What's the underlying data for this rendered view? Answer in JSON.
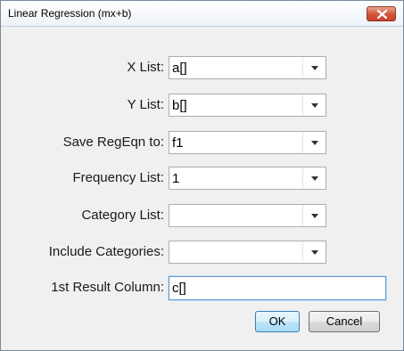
{
  "dialog": {
    "title": "Linear Regression (mx+b)"
  },
  "fields": [
    {
      "label": "X List:",
      "value": "a[]"
    },
    {
      "label": "Y List:",
      "value": "b[]"
    },
    {
      "label": "Save RegEqn to:",
      "value": "f1"
    },
    {
      "label": "Frequency List:",
      "value": "1"
    },
    {
      "label": "Category List:",
      "value": ""
    },
    {
      "label": "Include Categories:",
      "value": ""
    }
  ],
  "result_column": {
    "label": "1st Result Column:",
    "value": "c[]"
  },
  "buttons": {
    "ok": "OK",
    "cancel": "Cancel"
  },
  "colors": {
    "close_button": "#d2553a",
    "ok_border": "#3c7fb1",
    "focus_border": "#5b9bd5"
  },
  "icons": {
    "close": "close-icon",
    "dropdown": "chevron-down-icon"
  }
}
